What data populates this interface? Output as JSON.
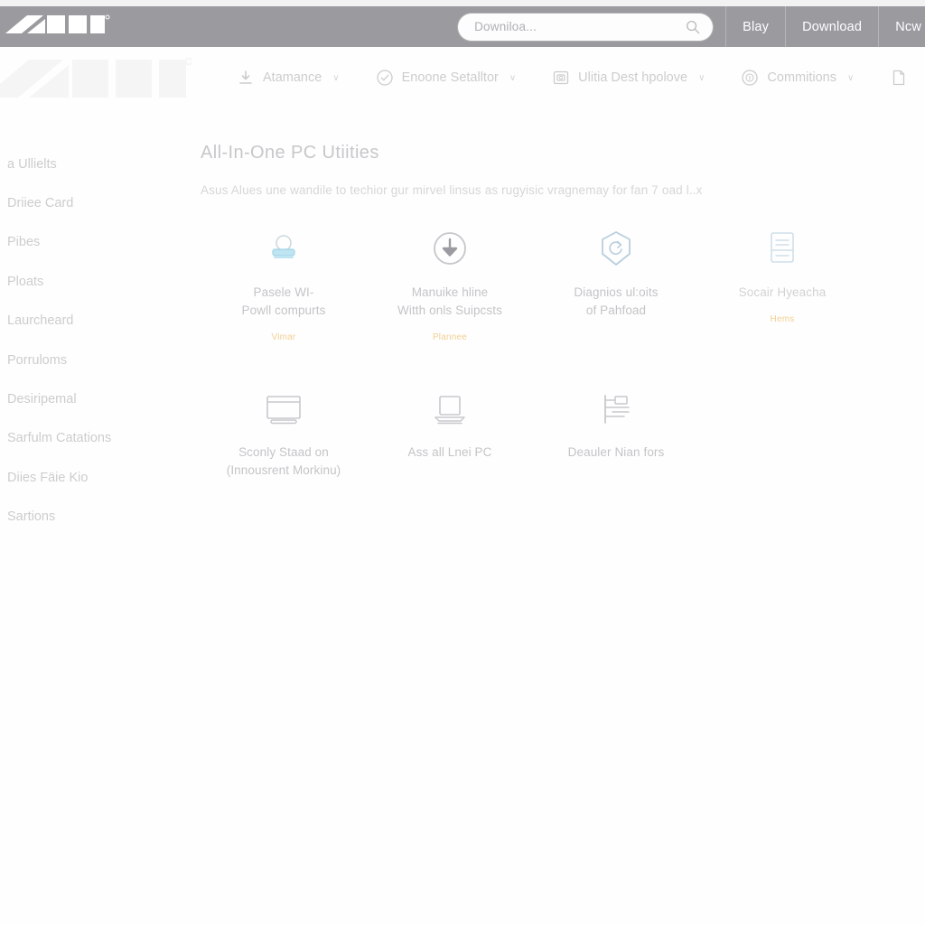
{
  "brand": {
    "name": "ASUS",
    "logo_watermark": "ASUS"
  },
  "header": {
    "search": {
      "value": "",
      "placeholder": "Downiloa...",
      "icon": "search-icon"
    },
    "nav": [
      {
        "label": "Blay"
      },
      {
        "label": "Download"
      },
      {
        "label": "Ncw"
      }
    ]
  },
  "subnav": [
    {
      "label": "Atamance",
      "icon": "download-icon",
      "caret": "∨"
    },
    {
      "label": "Enoone Setalltor",
      "icon": "check-circle-icon",
      "caret": "∨"
    },
    {
      "label": "Ulitia Dest hpolove",
      "icon": "monitor-icon",
      "caret": "∨"
    },
    {
      "label": "Commitions",
      "icon": "info-circle-icon",
      "caret": "∨"
    },
    {
      "label": "",
      "icon": "document-icon",
      "caret": ""
    }
  ],
  "sidebar": {
    "items": [
      {
        "label": "a Ullielts"
      },
      {
        "label": "Driiee Card"
      },
      {
        "label": "Pibes"
      },
      {
        "label": "Ploats"
      },
      {
        "label": "Laurcheard"
      },
      {
        "label": "Porruloms"
      },
      {
        "label": "Desiripemal"
      },
      {
        "label": "Sarfulm Catations"
      },
      {
        "label": "Diies Fäie Kio"
      },
      {
        "label": "Sartions"
      }
    ]
  },
  "main": {
    "title": "All-In-One PC Utiities",
    "description": "Asus  Alues une wandile to techior gur mirvel linsus as rugyisic vragnemay for fan 7 oad l..x",
    "cards": [
      {
        "title": "Pasele WI-\nPowll compurts",
        "link": "Vimar",
        "icon": "wifi-device-icon",
        "accent": "#9fd4e8"
      },
      {
        "title": "Manuike hline\nWitth onls Suipcsts",
        "link": "Plannee",
        "icon": "download-circle-icon",
        "accent": "#b8b8bd"
      },
      {
        "title": "Diagnios ul:oits\nof Pahfoad",
        "link": "",
        "icon": "shield-refresh-icon",
        "accent": "#b9cfdd"
      },
      {
        "title": "Socair Hyeacha",
        "link": "Hems",
        "icon": "list-document-icon",
        "accent": "#aac6d8"
      },
      {
        "title": "Sconly Staad on\n(Innousrent Morkinu)",
        "link": "",
        "icon": "monitor-screen-icon",
        "accent": "#c2c2c7"
      },
      {
        "title": "Ass all Lnei PC",
        "link": "",
        "icon": "laptop-icon",
        "accent": "#c2c2c7"
      },
      {
        "title": "Deauler Nian fors",
        "link": "",
        "icon": "hierarchy-tree-icon",
        "accent": "#c2c2c7"
      }
    ]
  },
  "colors": {
    "header_bar": "#9a9a9f",
    "accent_link": "#e8a93a",
    "text_muted": "#6e6e76",
    "page_bg": "#fefefe"
  }
}
